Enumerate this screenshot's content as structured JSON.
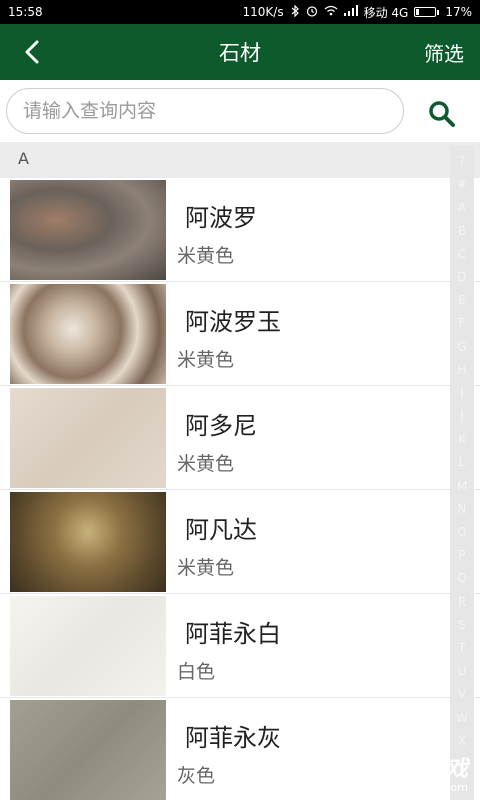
{
  "status_bar": {
    "time": "15:58",
    "network_speed": "110K/s",
    "carrier": "移动 4G",
    "battery_percent": "17%",
    "battery_level": 0.17
  },
  "app_bar": {
    "title": "石材",
    "filter_label": "筛选"
  },
  "search": {
    "placeholder": "请输入查询内容",
    "value": ""
  },
  "section": {
    "header": "A"
  },
  "items": [
    {
      "name": "阿波罗",
      "color": "米黄色"
    },
    {
      "name": "阿波罗玉",
      "color": "米黄色"
    },
    {
      "name": "阿多尼",
      "color": "米黄色"
    },
    {
      "name": "阿凡达",
      "color": "米黄色"
    },
    {
      "name": "阿菲永白",
      "color": "白色"
    },
    {
      "name": "阿菲永灰",
      "color": "灰色"
    }
  ],
  "index_bar": [
    "?",
    "#",
    "A",
    "B",
    "C",
    "D",
    "E",
    "F",
    "G",
    "H",
    "I",
    "J",
    "K",
    "L",
    "M",
    "N",
    "O",
    "P",
    "Q",
    "R",
    "S",
    "T",
    "U",
    "V",
    "W",
    "X"
  ],
  "watermark": {
    "text": "9l游戏",
    "subtext": "91danji.com"
  },
  "colors": {
    "app_bar": "#0d5a2c",
    "search_icon": "#0d5a2c"
  }
}
